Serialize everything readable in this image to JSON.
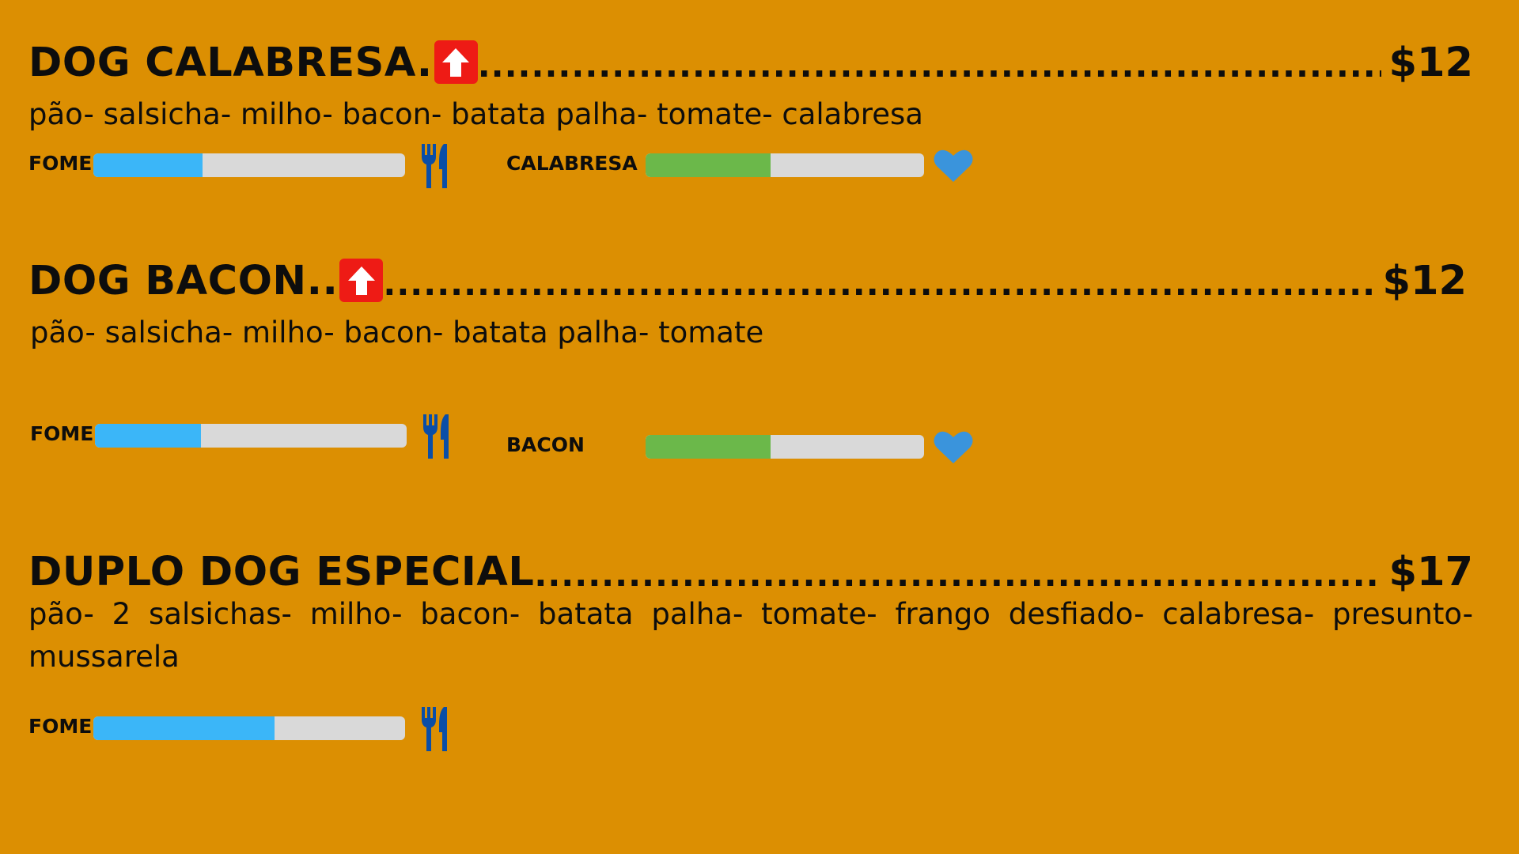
{
  "colors": {
    "background": "#dc8f02",
    "hunger_bar": "#3bb6f8",
    "like_bar": "#6bb84a",
    "track": "#d9d9d9",
    "fork_icon": "#0a4ea7",
    "heart_icon": "#3a94dc",
    "up_badge": "#ee1b15"
  },
  "items": [
    {
      "name": "DOG CALABRESA.",
      "badge_icon": "up-arrow-icon",
      "leader": "............................................................................................................................",
      "price": "$12",
      "description": "pão- salsicha- milho- bacon- batata palha- tomate- calabresa",
      "hunger": {
        "label": "FOME",
        "level": 0.35,
        "icon": "fork-knife-icon"
      },
      "like": {
        "label": "CALABRESA",
        "level": 0.45,
        "icon": "heart-icon"
      }
    },
    {
      "name": "DOG BACON..",
      "badge_icon": "up-arrow-icon",
      "leader": "............................................................................................................................",
      "price": "$12",
      "description": "pão- salsicha- milho- bacon- batata palha- tomate",
      "hunger": {
        "label": "FOME",
        "level": 0.34,
        "icon": "fork-knife-icon"
      },
      "like": {
        "label": "BACON",
        "level": 0.45,
        "icon": "heart-icon"
      }
    },
    {
      "name": "DUPLO DOG ESPECIAL",
      "leader": "............................................................................................................................",
      "price": "$17",
      "description": "pão- 2 salsichas- milho- bacon- batata palha- tomate- frango desfiado- calabresa- presunto- mussarela",
      "hunger": {
        "label": "FOME",
        "level": 0.58,
        "icon": "fork-knife-icon"
      }
    }
  ]
}
